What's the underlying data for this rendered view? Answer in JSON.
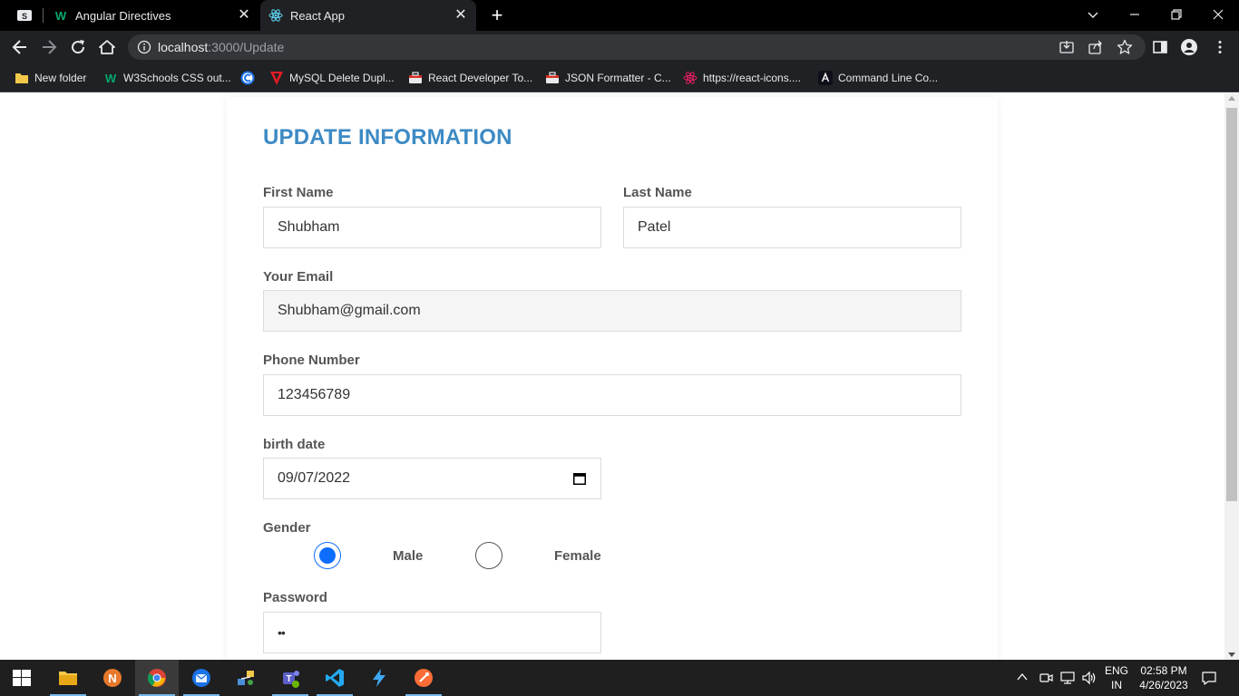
{
  "browser": {
    "tabs": [
      {
        "label": "Angular Directives",
        "icon": "w3schools-icon"
      },
      {
        "label": "React App",
        "icon": "react-icon",
        "active": true
      }
    ],
    "address": {
      "host": "localhost",
      "path": ":3000/Update"
    },
    "bookmarks": [
      {
        "label": "New folder",
        "icon": "folder-icon"
      },
      {
        "label": "W3Schools CSS out...",
        "icon": "w3schools-icon"
      },
      {
        "label": "",
        "icon": "circle-c-icon"
      },
      {
        "label": "MySQL Delete Dupl...",
        "icon": "v-logo-icon"
      },
      {
        "label": "React Developer To...",
        "icon": "toolbox-icon"
      },
      {
        "label": "JSON Formatter - C...",
        "icon": "toolbox-icon"
      },
      {
        "label": "https://react-icons....",
        "icon": "react-icon"
      },
      {
        "label": "Command Line Co...",
        "icon": "angular-icon"
      }
    ]
  },
  "form": {
    "title": "UPDATE INFORMATION",
    "first_name": {
      "label": "First Name",
      "value": "Shubham"
    },
    "last_name": {
      "label": "Last Name",
      "value": "Patel"
    },
    "email": {
      "label": "Your Email",
      "value": "Shubham@gmail.com"
    },
    "phone": {
      "label": "Phone Number",
      "value": "123456789"
    },
    "birth_date": {
      "label": "birth date",
      "value": "09/07/2022"
    },
    "gender": {
      "label": "Gender",
      "options": [
        "Male",
        "Female"
      ],
      "selected": "Male"
    },
    "password": {
      "label": "Password",
      "value": "••"
    }
  },
  "taskbar": {
    "language": {
      "line1": "ENG",
      "line2": "IN"
    },
    "time": "02:58 PM",
    "date": "4/26/2023"
  },
  "colors": {
    "title": "#3d8ac4",
    "radio_selected": "#0d6efd",
    "chrome_dark": "#202124"
  }
}
